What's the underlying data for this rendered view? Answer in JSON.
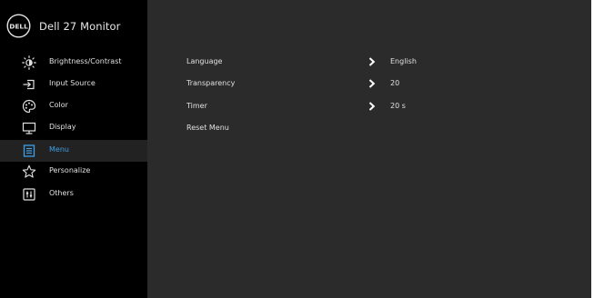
{
  "header": {
    "logo_text": "DELL",
    "model_name": "Dell 27 Monitor"
  },
  "sidebar": {
    "items": [
      {
        "label": "Brightness/Contrast",
        "icon": "brightness-icon"
      },
      {
        "label": "Input Source",
        "icon": "input-source-icon"
      },
      {
        "label": "Color",
        "icon": "color-palette-icon"
      },
      {
        "label": "Display",
        "icon": "display-monitor-icon"
      },
      {
        "label": "Menu",
        "icon": "menu-icon",
        "selected": true
      },
      {
        "label": "Personalize",
        "icon": "star-icon"
      },
      {
        "label": "Others",
        "icon": "others-icon"
      }
    ]
  },
  "menu_options": [
    {
      "label": "Language",
      "value": "English",
      "has_arrow": true
    },
    {
      "label": "Transparency",
      "value": "20",
      "has_arrow": true
    },
    {
      "label": "Timer",
      "value": "20 s",
      "has_arrow": true
    },
    {
      "label": "Reset Menu",
      "value": "",
      "has_arrow": false
    }
  ],
  "colors": {
    "sidebar_bg": "#000000",
    "main_bg": "#2b2b2b",
    "selected_bg": "#222222",
    "accent": "#3e9fe6",
    "text": "#e0e0e0"
  }
}
